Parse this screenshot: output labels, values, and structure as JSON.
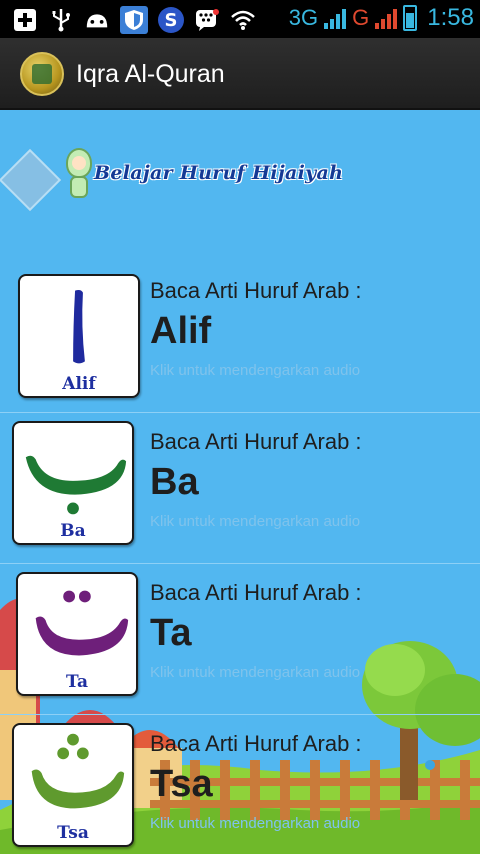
{
  "status_bar": {
    "left_icons": [
      "add-icon",
      "usb-icon",
      "android-icon",
      "shield-icon",
      "s-app-icon",
      "bbm-icon",
      "wifi-icon"
    ],
    "network_1": "3G",
    "network_2": "G",
    "time": "1:58",
    "accent_color": "#39b8e0"
  },
  "app_bar": {
    "title": "Iqra Al-Quran",
    "logo_icon": "quran-logo-icon"
  },
  "banner": {
    "text": "Belajar Huruf Hijaiyah"
  },
  "letters": [
    {
      "arabic": "ا",
      "caption": "Alif",
      "heading": "Baca Arti Huruf Arab :",
      "name": "Alif",
      "hint": "Klik untuk mendengarkan audio",
      "color": "#1f2a9e"
    },
    {
      "arabic": "ب",
      "caption": "Ba",
      "heading": "Baca Arti Huruf Arab :",
      "name": "Ba",
      "hint": "Klik untuk mendengarkan audio",
      "color": "#1f7a34"
    },
    {
      "arabic": "ت",
      "caption": "Ta",
      "heading": "Baca Arti Huruf Arab :",
      "name": "Ta",
      "hint": "Klik untuk mendengarkan audio",
      "color": "#6e1f7a"
    },
    {
      "arabic": "ث",
      "caption": "Tsa",
      "heading": "Baca Arti Huruf Arab :",
      "name": "Tsa",
      "hint": "Klik untuk mendengarkan audio",
      "color": "#5f9a2e"
    }
  ],
  "colors": {
    "content_bg": "#52b7f0",
    "caption": "#1e2fa0",
    "hint": "#7fc3ec"
  }
}
